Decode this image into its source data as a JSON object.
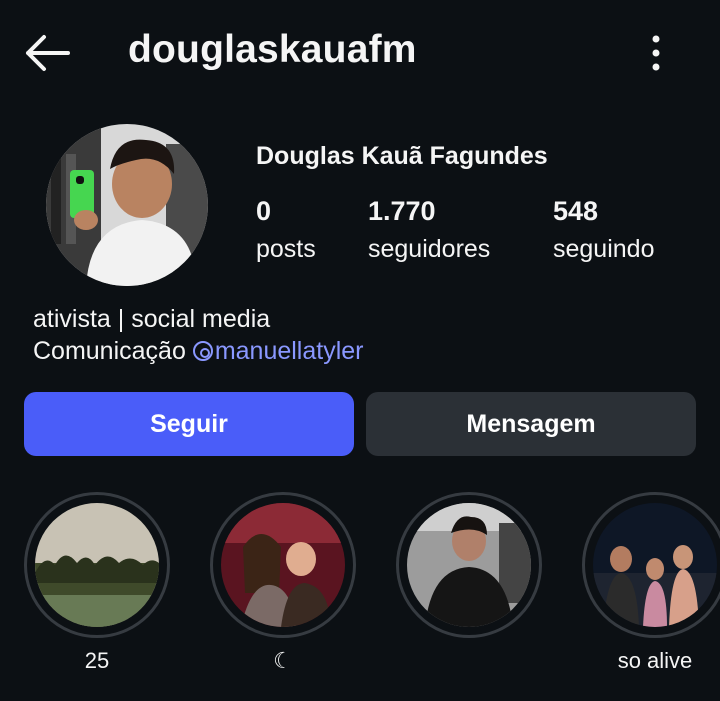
{
  "header": {
    "username": "douglaskauafm",
    "back_icon": "arrow-left-icon",
    "menu_icon": "more-vertical-icon"
  },
  "profile": {
    "full_name": "Douglas Kauã Fagundes",
    "stats": [
      {
        "value": "0",
        "label": "posts"
      },
      {
        "value": "1.770",
        "label": "seguidores"
      },
      {
        "value": "548",
        "label": "seguindo"
      }
    ],
    "bio_line1": "ativista | social media",
    "bio_line2_prefix": "Comunicação ",
    "bio_mention": "manuellatyler"
  },
  "actions": {
    "follow_label": "Seguir",
    "message_label": "Mensagem"
  },
  "highlights": [
    {
      "caption": "25"
    },
    {
      "caption": "☾"
    },
    {
      "caption": ""
    },
    {
      "caption": "so alive"
    }
  ],
  "colors": {
    "background": "#0c1014",
    "accent": "#4a5df9",
    "mention": "#8a98ff",
    "secondary_button": "#2b3036"
  }
}
